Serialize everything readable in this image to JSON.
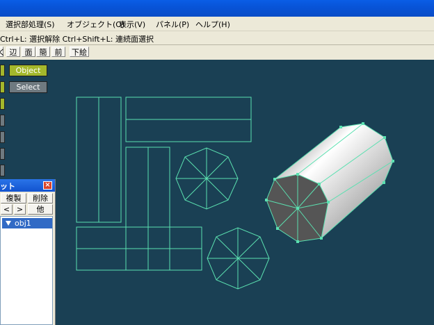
{
  "menu": [
    "選択部処理(S)",
    "オブジェクト(O)",
    "表示(V)",
    "パネル(P)",
    "ヘルプ(H)"
  ],
  "hint": "Ctrl+L: 選択解除  Ctrl+Shift+L: 連続面選択",
  "toolbar": {
    "cut": "く",
    "edge": "辺",
    "face": "面",
    "simple": "簡",
    "front": "前",
    "underpaint": "下絵"
  },
  "modes": {
    "object": "Object",
    "select": "Select"
  },
  "objpanel": {
    "title": "ット",
    "copy": "複製",
    "delete": "削除",
    "prev": "<",
    "next": ">",
    "other": "他",
    "items": [
      "obj1"
    ]
  },
  "colors": {
    "viewport": "#1a4054",
    "wire": "#5be0b0",
    "active_mode": "#a4b82c",
    "inactive_mode": "#6f7a80"
  }
}
